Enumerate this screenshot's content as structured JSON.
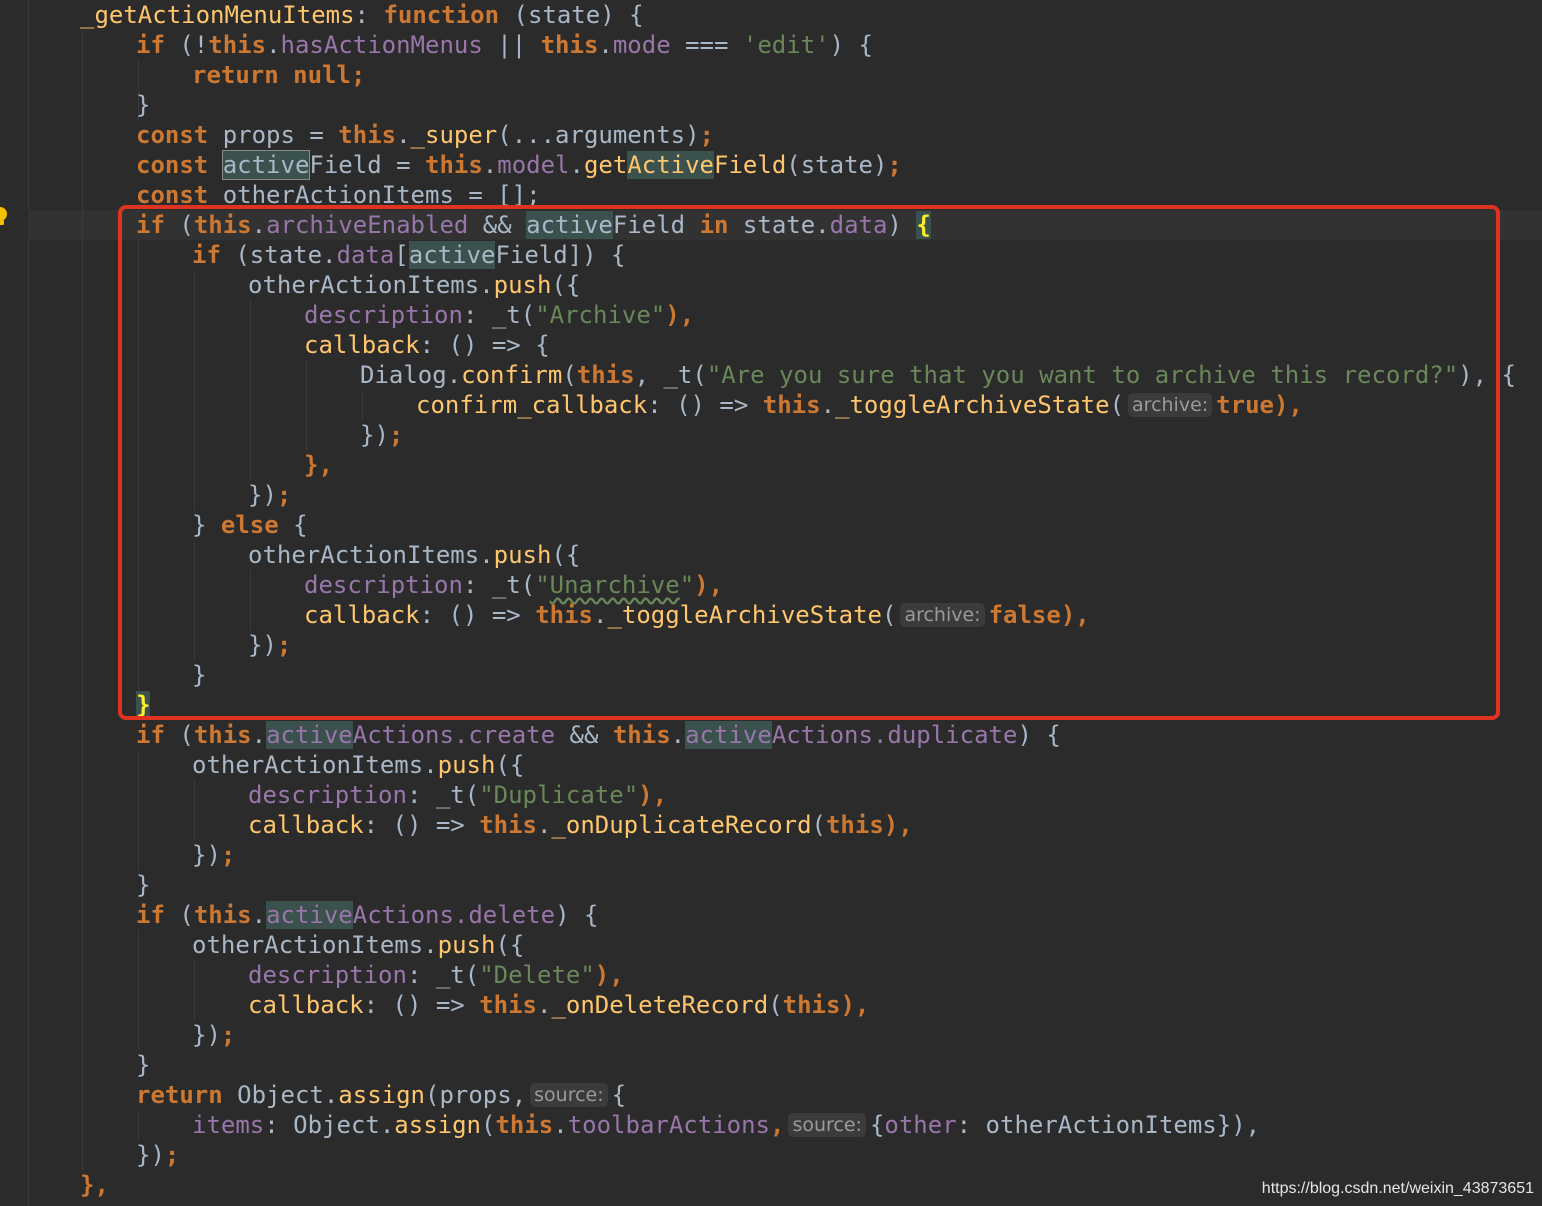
{
  "editor": {
    "theme_background": "#2b2b2b",
    "highlight_box_color": "#e0331f",
    "intention_icon": "lightbulb-icon",
    "lines": {
      "l1": {
        "name": "_getActionMenuItems",
        "colon": ": ",
        "kw": "function",
        "rest": " (state) {"
      },
      "l2": {
        "if": "if",
        "open": " (!",
        "this": "this",
        "dot": ".",
        "prop": "hasActionMenus",
        "or": " || ",
        "this2": "this",
        "dot2": ".",
        "prop2": "mode",
        "eq": " === ",
        "str": "'edit'",
        "close": ") {"
      },
      "l3": {
        "ret": "return",
        "sp": " ",
        "nul": "null",
        "semi": ";"
      },
      "l4": {
        "text": "}"
      },
      "l5": {
        "const": "const",
        "mid": " props = ",
        "this": "this",
        "dot": ".",
        "fn": "_super",
        "rest": "(...arguments)",
        "semi": ";"
      },
      "l6": {
        "const": "const",
        "sp": " ",
        "hl": "active",
        "mid": "Field = ",
        "this": "this",
        "dot": ".",
        "prop": "model",
        "dot2": ".",
        "fn": "get",
        "fnhl": "Active",
        "fn2": "Field",
        "rest": "(state)",
        "semi": ";"
      },
      "l7": {
        "const": "const",
        "rest": " otherActionItems = [];"
      },
      "l8": {
        "if": "if",
        "open": " (",
        "this": "this",
        "dot": ".",
        "prop": "archiveEnabled",
        "and": " && ",
        "hl": "active",
        "field": "Field ",
        "in": "in",
        "mid": " state.",
        "prop2": "data",
        "close": ") ",
        "brace": "{"
      },
      "l9": {
        "if": "if",
        "open": " (state.",
        "prop": "data",
        "br": "[",
        "hl": "active",
        "rest": "Field]) {"
      },
      "l10": {
        "obj": "otherActionItems.",
        "fn": "push",
        "rest": "({"
      },
      "l11": {
        "prop": "description",
        "mid": ": _t(",
        "str": "\"Archive\"",
        "rest": "),"
      },
      "l12": {
        "fn": "callback",
        "rest": ": () => {"
      },
      "l13": {
        "obj": "Dialog.",
        "fn": "confirm",
        "open": "(",
        "this": "this",
        "mid": ", _t(",
        "str": "\"Are you sure that you want to archive this record?\"",
        "rest": "), {"
      },
      "l14": {
        "fn": "confirm_callback",
        "mid": ": () => ",
        "this": "this",
        "dot": ".",
        "fn2": "_toggleArchiveState",
        "open": "(",
        "hint": "archive:",
        "val": "true",
        "rest": "),"
      },
      "l15": {
        "text": "})",
        "semi": ";"
      },
      "l16": {
        "text": "},"
      },
      "l17": {
        "text": "})",
        "semi": ";"
      },
      "l18": {
        "pre": "} ",
        "kw": "else",
        "rest": " {"
      },
      "l19": {
        "obj": "otherActionItems.",
        "fn": "push",
        "rest": "({"
      },
      "l20": {
        "prop": "description",
        "mid": ": _t(",
        "q1": "\"",
        "str": "Unarchive",
        "q2": "\"",
        "rest": "),"
      },
      "l21": {
        "fn": "callback",
        "mid": ": () => ",
        "this": "this",
        "dot": ".",
        "fn2": "_toggleArchiveState",
        "open": "(",
        "hint": "archive:",
        "val": "false",
        "rest": "),"
      },
      "l22": {
        "text": "})",
        "semi": ";"
      },
      "l23": {
        "text": "}"
      },
      "l24": {
        "text": "}"
      },
      "l25": {
        "if": "if",
        "open": " (",
        "this": "this",
        "dot": ".",
        "hl": "active",
        "prop": "Actions.create",
        "and": " && ",
        "this2": "this",
        "dot2": ".",
        "hl2": "active",
        "prop2": "Actions.duplicate",
        "close": ") {"
      },
      "l26": {
        "obj": "otherActionItems.",
        "fn": "push",
        "rest": "({"
      },
      "l27": {
        "prop": "description",
        "mid": ": _t(",
        "str": "\"Duplicate\"",
        "rest": "),"
      },
      "l28": {
        "fn": "callback",
        "mid": ": () => ",
        "this": "this",
        "dot": ".",
        "fn2": "_onDuplicateRecord",
        "open": "(",
        "this2": "this",
        "rest": "),"
      },
      "l29": {
        "text": "})",
        "semi": ";"
      },
      "l30": {
        "text": "}"
      },
      "l31": {
        "if": "if",
        "open": " (",
        "this": "this",
        "dot": ".",
        "hl": "active",
        "prop": "Actions.delete",
        "close": ") {"
      },
      "l32": {
        "obj": "otherActionItems.",
        "fn": "push",
        "rest": "({"
      },
      "l33": {
        "prop": "description",
        "mid": ": _t(",
        "str": "\"Delete\"",
        "rest": "),"
      },
      "l34": {
        "fn": "callback",
        "mid": ": () => ",
        "this": "this",
        "dot": ".",
        "fn2": "_onDeleteRecord",
        "open": "(",
        "this2": "this",
        "rest": "),"
      },
      "l35": {
        "text": "})",
        "semi": ";"
      },
      "l36": {
        "text": "}"
      },
      "l37": {
        "ret": "return",
        "mid": " Object.",
        "fn": "assign",
        "open": "(props,",
        "hint": "source:",
        "rest": "{"
      },
      "l38": {
        "prop": "items",
        "mid": ": Object.",
        "fn": "assign",
        "open": "(",
        "this": "this",
        "dot": ".",
        "prop2": "toolbarActions",
        "comma": ",",
        "hint": "source:",
        "br": "{",
        "prop3": "other",
        "rest": ": otherActionItems}),"
      },
      "l39": {
        "text": "})",
        "semi": ";"
      },
      "l40": {
        "text": "},"
      }
    }
  },
  "watermark": "https://blog.csdn.net/weixin_43873651"
}
